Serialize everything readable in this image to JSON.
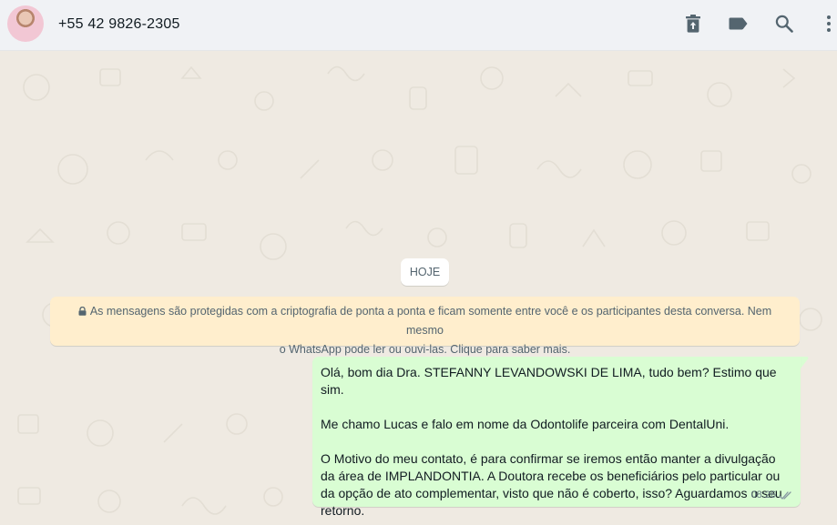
{
  "header": {
    "contact": "+55 42 9826-2305",
    "icons": [
      "delete-icon",
      "label-icon",
      "search-icon",
      "menu-icon"
    ]
  },
  "chat": {
    "date_chip": "HOJE",
    "encryption_notice": {
      "line1": "As mensagens são protegidas com a criptografia de ponta a ponta e ficam somente entre você e os participantes desta conversa. Nem mesmo",
      "line2": "o WhatsApp pode ler ou ouvi-las. Clique para saber mais."
    },
    "message": {
      "p1": "Olá, bom dia Dra. STEFANNY LEVANDOWSKI DE LIMA, tudo bem? Estimo que sim.",
      "p2": "Me chamo Lucas e falo em nome da Odontolife parceira com DentalUni.",
      "p3_lines": [
        "O Motivo do meu contato, é para confirmar se iremos então manter a divulgação",
        "da área de IMPLANDONTIA. A Doutora recebe os beneficiários pelo particular ou",
        "da opção de ato complementar, visto que não é coberto, isso? Aguardamos o seu",
        "retorno."
      ],
      "time": "08:26"
    }
  },
  "colors": {
    "header_bg": "#f0f2f5",
    "chat_bg": "#efeae2",
    "outgoing_bubble": "#d9fdd3",
    "notice_bg": "#ffeecd",
    "icon": "#54656f",
    "ticks": "#8696a0"
  }
}
